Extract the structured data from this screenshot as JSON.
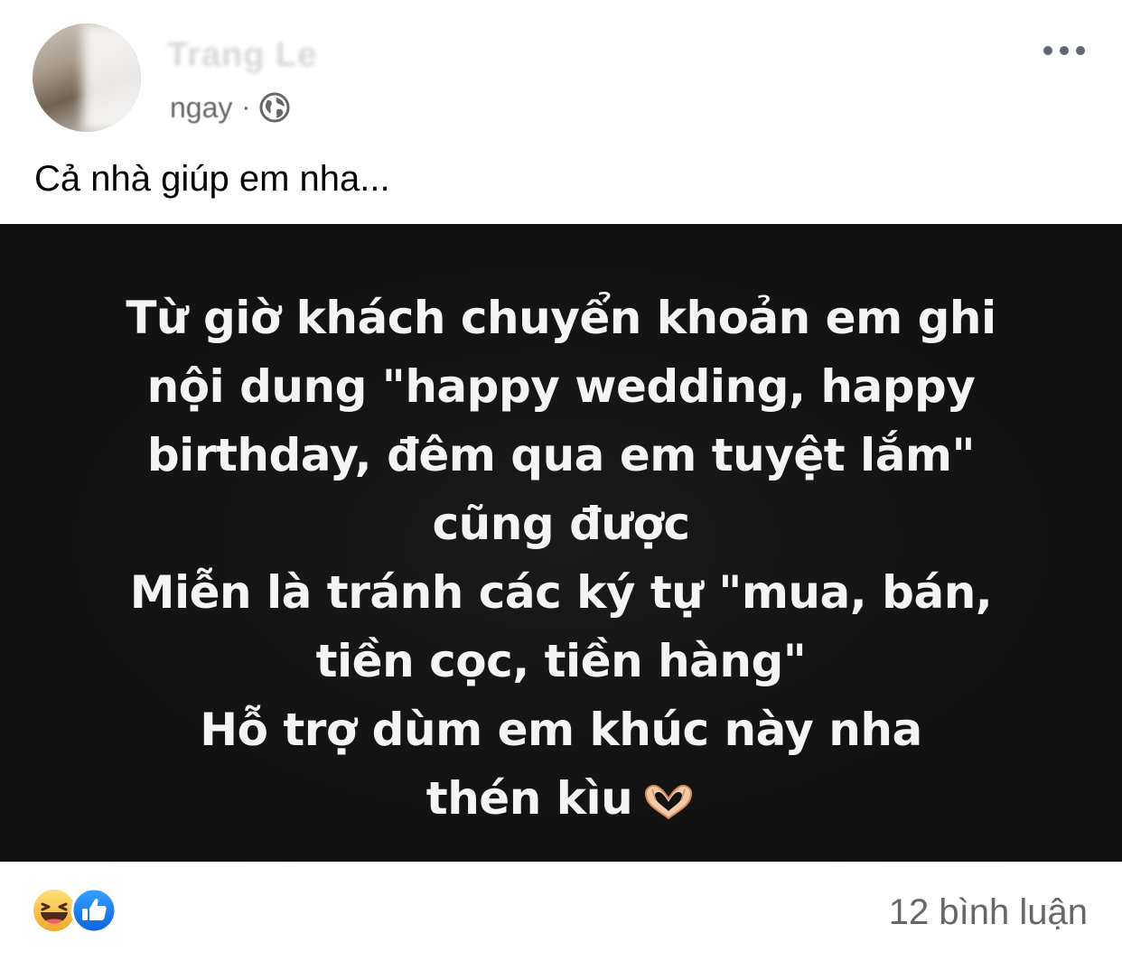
{
  "post": {
    "author_name": "Trang Le",
    "timestamp": "ngay",
    "meta_separator": "·",
    "privacy_icon": "globe-icon",
    "more_icon": "more-options-icon",
    "caption": "Cả nhà giúp em nha..."
  },
  "media": {
    "background_color": "#121212",
    "text_lines": [
      "Từ giờ khách chuyển khoản em ghi",
      "nội dung \"happy wedding, happy",
      "birthday, đêm qua em tuyệt lắm\"",
      "cũng được",
      "Miễn là tránh các ký tự \"mua, bán,",
      "tiền cọc, tiền hàng\"",
      "Hỗ trợ dùm em khúc này nha",
      "thén kìu"
    ],
    "trailing_icon": "heart-hands-icon"
  },
  "footer": {
    "reactions": [
      "haha-reaction-icon",
      "like-reaction-icon"
    ],
    "comment_count_label": "12 bình luận"
  },
  "colors": {
    "secondary_text": "#65676b",
    "primary_text": "#050505",
    "like_blue": "#1877f2",
    "haha_yellow": "#f7b125"
  }
}
